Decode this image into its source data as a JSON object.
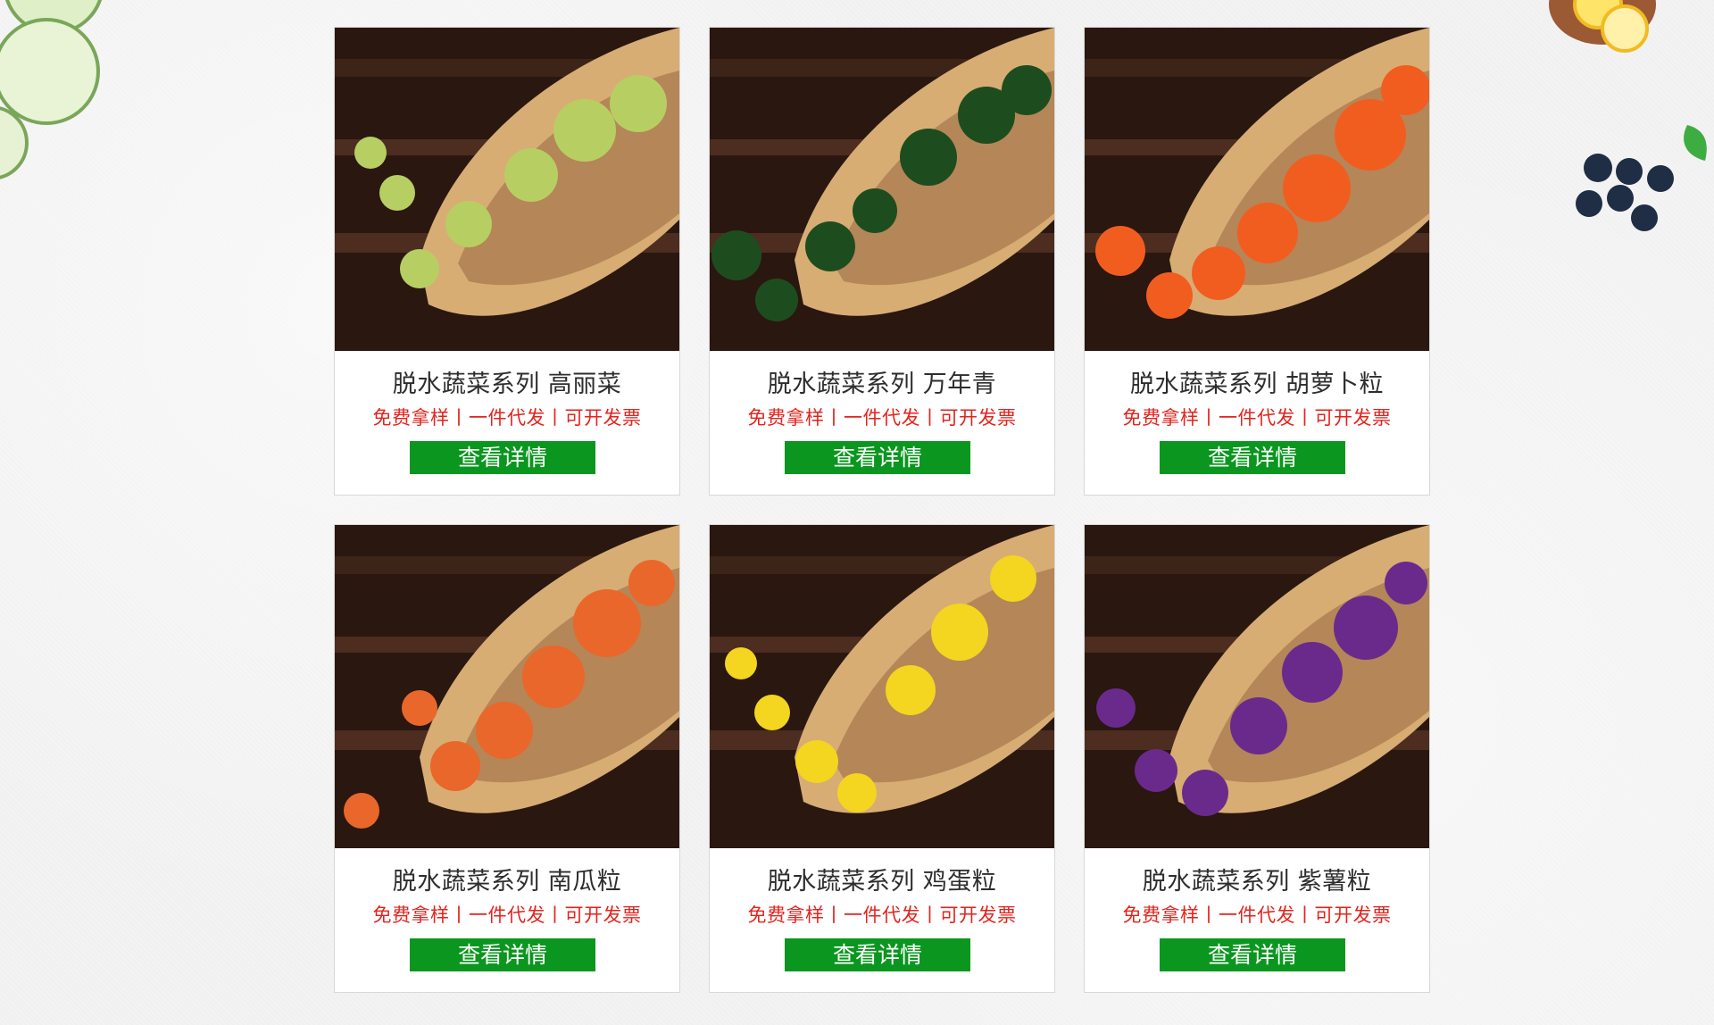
{
  "products": [
    {
      "title": "脱水蔬菜系列 高丽菜",
      "tags": "免费拿样丨一件代发丨可开发票",
      "button": "查看详情",
      "image": "dried-cabbage-in-wooden-scoop",
      "food_color": "#b7cf62"
    },
    {
      "title": "脱水蔬菜系列 万年青",
      "tags": "免费拿样丨一件代发丨可开发票",
      "button": "查看详情",
      "image": "dried-greens-in-wooden-scoop",
      "food_color": "#1d4d1e"
    },
    {
      "title": "脱水蔬菜系列 胡萝卜粒",
      "tags": "免费拿样丨一件代发丨可开发票",
      "button": "查看详情",
      "image": "dried-carrot-in-wooden-scoop",
      "food_color": "#f15d1f"
    },
    {
      "title": "脱水蔬菜系列 南瓜粒",
      "tags": "免费拿样丨一件代发丨可开发票",
      "button": "查看详情",
      "image": "dried-pumpkin-in-wooden-scoop",
      "food_color": "#e9672a"
    },
    {
      "title": "脱水蔬菜系列 鸡蛋粒",
      "tags": "免费拿样丨一件代发丨可开发票",
      "button": "查看详情",
      "image": "dried-egg-in-wooden-scoop",
      "food_color": "#f4d51f"
    },
    {
      "title": "脱水蔬菜系列 紫薯粒",
      "tags": "免费拿样丨一件代发丨可开发票",
      "button": "查看详情",
      "image": "dried-purple-sweet-potato-in-wooden-scoop",
      "food_color": "#6a2a8c"
    }
  ],
  "decorations": {
    "left": "cucumber-slices",
    "top_right": "lemon-on-spoon",
    "right": "blueberries"
  },
  "colors": {
    "button": "#0b961f",
    "tag_text": "#e3231d",
    "title_text": "#2d2d2d"
  }
}
